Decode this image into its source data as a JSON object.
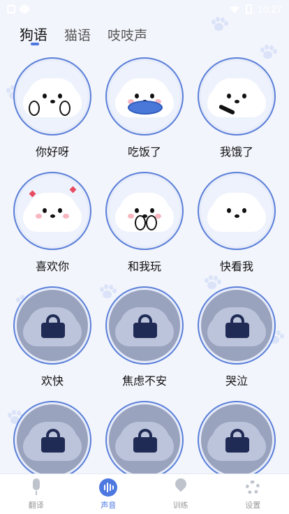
{
  "status": {
    "time": "10:27"
  },
  "tabs": [
    {
      "label": "狗语",
      "active": true
    },
    {
      "label": "猫语",
      "active": false
    },
    {
      "label": "吱吱声",
      "active": false
    }
  ],
  "items": [
    {
      "label": "你好呀",
      "locked": false
    },
    {
      "label": "吃饭了",
      "locked": false
    },
    {
      "label": "我饿了",
      "locked": false
    },
    {
      "label": "喜欢你",
      "locked": false
    },
    {
      "label": "和我玩",
      "locked": false
    },
    {
      "label": "快看我",
      "locked": false
    },
    {
      "label": "欢快",
      "locked": true
    },
    {
      "label": "焦虑不安",
      "locked": true
    },
    {
      "label": "哭泣",
      "locked": true
    },
    {
      "label": "",
      "locked": true
    },
    {
      "label": "",
      "locked": true
    },
    {
      "label": "",
      "locked": true
    }
  ],
  "nav": [
    {
      "label": "翻译",
      "icon": "microphone-icon",
      "active": false
    },
    {
      "label": "声音",
      "icon": "sound-wave-icon",
      "active": true
    },
    {
      "label": "训练",
      "icon": "location-pin-icon",
      "active": false
    },
    {
      "label": "设置",
      "icon": "gear-icon",
      "active": false
    }
  ],
  "colors": {
    "accent": "#4c78e0",
    "background": "#f3f5fc",
    "lock": "#1f2a55"
  }
}
